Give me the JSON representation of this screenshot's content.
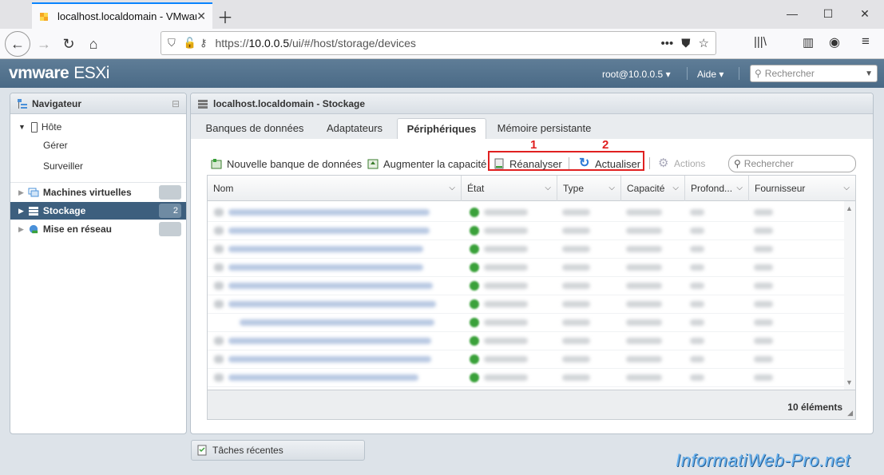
{
  "browser": {
    "tab_title": "localhost.localdomain - VMware ESXi",
    "url_prefix": "https://",
    "url_host": "10.0.0.5",
    "url_path": "/ui/#/host/storage/devices"
  },
  "esxi": {
    "logo_vm": "vmware",
    "logo_product": "ESXi",
    "user": "root@10.0.0.5 ▾",
    "help": "Aide ▾",
    "search_placeholder": "Rechercher"
  },
  "navigator": {
    "title": "Navigateur",
    "host": "Hôte",
    "host_items": [
      "Gérer",
      "Surveiller"
    ],
    "vms": "Machines virtuelles",
    "vms_count": "",
    "storage": "Stockage",
    "storage_count": "2",
    "network": "Mise en réseau",
    "network_count": ""
  },
  "main": {
    "title": "localhost.localdomain - Stockage",
    "tabs": [
      "Banques de données",
      "Adaptateurs",
      "Périphériques",
      "Mémoire persistante"
    ],
    "toolbar": {
      "new_datastore": "Nouvelle banque de données",
      "increase_capacity": "Augmenter la capacité",
      "rescan": "Réanalyser",
      "refresh": "Actualiser",
      "actions": "Actions",
      "search_placeholder": "Rechercher"
    },
    "annotations": [
      "1",
      "2"
    ],
    "columns": [
      "Nom",
      "État",
      "Type",
      "Capacité",
      "Profond...",
      "Fournisseur"
    ],
    "row_count": 10,
    "footer": "10 éléments"
  },
  "recent_tasks": "Tâches récentes",
  "watermark": "InformatiWeb-Pro.net",
  "colors": {
    "accent": "#0a84ff",
    "header": "#4a6a86",
    "selected": "#3d5f7e",
    "annotation": "#e02020"
  }
}
